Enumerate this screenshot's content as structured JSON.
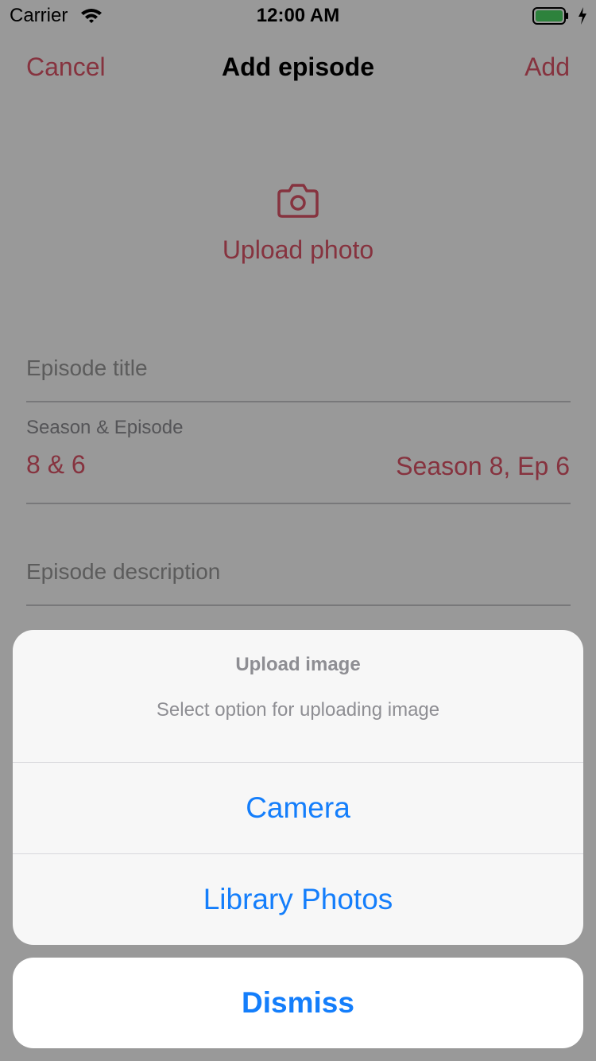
{
  "status_bar": {
    "carrier": "Carrier",
    "time": "12:00 AM",
    "icons": [
      "wifi-icon",
      "battery-icon",
      "charging-bolt-icon"
    ]
  },
  "nav": {
    "cancel_label": "Cancel",
    "title": "Add episode",
    "add_label": "Add"
  },
  "upload": {
    "icon": "camera-icon",
    "label": "Upload photo"
  },
  "form": {
    "episode_title_placeholder": "Episode title",
    "season_episode_label": "Season & Episode",
    "season_episode_value": "8 & 6",
    "season_episode_summary": "Season 8, Ep 6",
    "episode_description_placeholder": "Episode description"
  },
  "action_sheet": {
    "title": "Upload image",
    "message": "Select option for uploading image",
    "options": [
      "Camera",
      "Library Photos"
    ],
    "dismiss_label": "Dismiss"
  },
  "colors": {
    "accent": "#e05569",
    "action_blue": "#147efb",
    "overlay": "rgba(0,0,0,0.4)",
    "battery_green": "#4cd964"
  }
}
